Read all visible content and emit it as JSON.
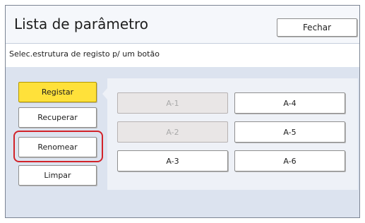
{
  "dialog": {
    "title": "Lista de parâmetro",
    "close_label": "Fechar",
    "instruction": "Selec.estrutura de registo p/ um botão"
  },
  "actions": {
    "register": "Registar",
    "recall": "Recuperar",
    "rename": "Renomear",
    "clear": "Limpar"
  },
  "slots": {
    "a1": "A-1",
    "a2": "A-2",
    "a3": "A-3",
    "a4": "A-4",
    "a5": "A-5",
    "a6": "A-6"
  },
  "colors": {
    "active_button": "#ffe13a",
    "highlight_ring": "#d2232a",
    "dialog_background": "#dce3ef"
  }
}
